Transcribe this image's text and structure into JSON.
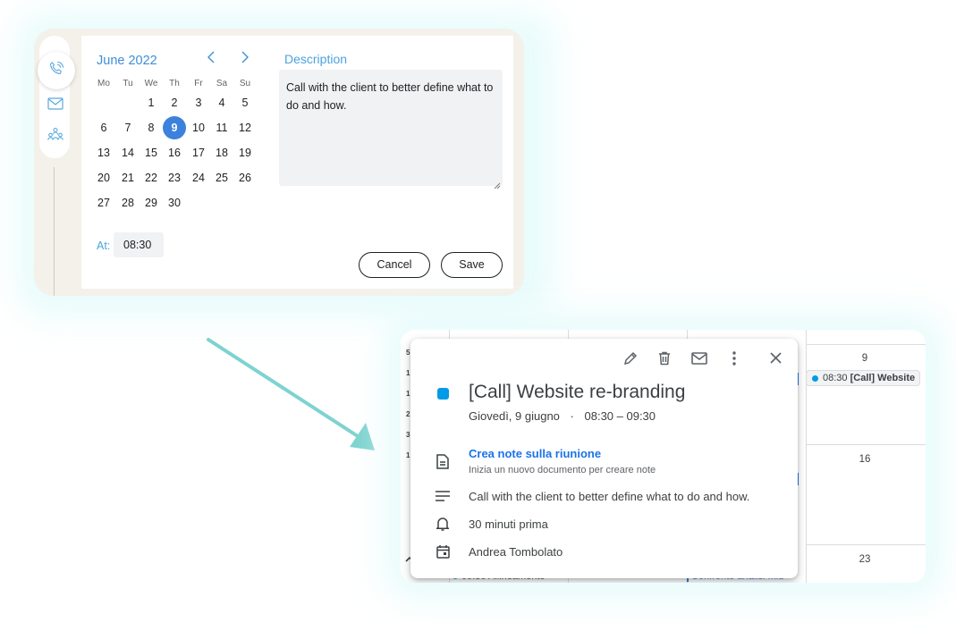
{
  "scheduler": {
    "calendar": {
      "month_label": "June 2022",
      "weekdays": [
        "Mo",
        "Tu",
        "We",
        "Th",
        "Fr",
        "Sa",
        "Su"
      ],
      "days": [
        "1",
        "2",
        "3",
        "4",
        "5",
        "6",
        "7",
        "8",
        "9",
        "10",
        "11",
        "12",
        "13",
        "14",
        "15",
        "16",
        "17",
        "18",
        "19",
        "20",
        "21",
        "22",
        "23",
        "24",
        "25",
        "26",
        "27",
        "28",
        "29",
        "30"
      ],
      "selected_day": "9"
    },
    "time": {
      "label": "At:",
      "value": "08:30"
    },
    "description": {
      "label": "Description",
      "text": "Call with the client to better define what to do and how."
    },
    "buttons": {
      "cancel": "Cancel",
      "save": "Save"
    },
    "colors": {
      "accent": "#3c82dc",
      "label": "#4aa3df"
    }
  },
  "calendar_view": {
    "background": {
      "day_numbers": [
        "9",
        "16",
        "23"
      ],
      "chip": {
        "time": "08:30",
        "title": "[Call] Website"
      },
      "bottom_left_event": "09:30 Allineamento",
      "bottom_mid_event": "Confronto analisi mid",
      "time_markers": [
        "5",
        "1",
        "1",
        "2",
        "3",
        "1"
      ]
    },
    "popup": {
      "toolbar_icons": [
        "edit-icon",
        "delete-icon",
        "email-icon",
        "more-options-icon",
        "close-icon"
      ],
      "event_color": "#039be5",
      "title": "[Call] Website re-branding",
      "date": "Giovedì, 9 giugno",
      "separator": "·",
      "time_range": "08:30 – 09:30",
      "notes_link": "Crea note sulla riunione",
      "notes_sub": "Inizia un nuovo documento per creare note",
      "description": "Call with the client to better define what to do and how.",
      "reminder": "30 minuti prima",
      "organizer": "Andrea Tombolato"
    }
  }
}
